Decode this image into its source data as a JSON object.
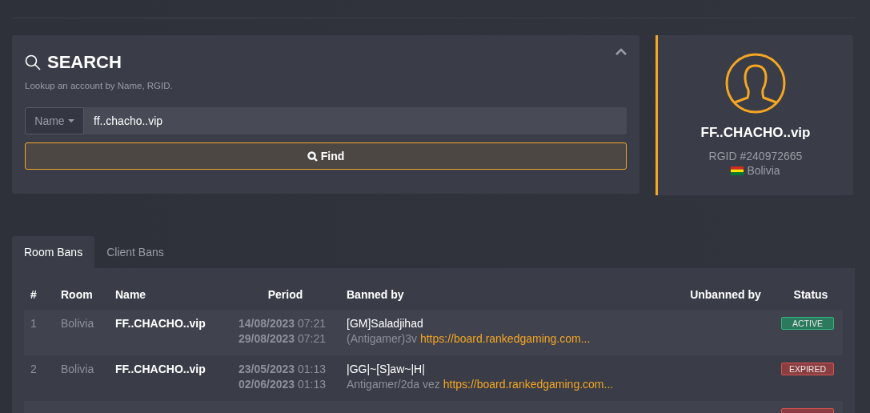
{
  "search": {
    "title": "SEARCH",
    "subtitle": "Lookup an account by Name, RGID.",
    "type_selector": "Name",
    "value": "ff..chacho..vip",
    "button": "Find",
    "collapsed": false
  },
  "profile": {
    "name": "FF..CHACHO..vip",
    "rgid": "RGID #240972665",
    "country": "Bolivia"
  },
  "tabs": [
    {
      "label": "Room Bans",
      "selected": true
    },
    {
      "label": "Client Bans",
      "selected": false
    }
  ],
  "table": {
    "columns": [
      "#",
      "Room",
      "Name",
      "Period",
      "Banned by",
      "Unbanned by",
      "Status"
    ],
    "rows": [
      {
        "index": "1",
        "room": "Bolivia",
        "name": "FF..CHACHO..vip",
        "start_date": "14/08/2023",
        "start_time": "07:21",
        "end_date": "29/08/2023",
        "end_time": "07:21",
        "banned_by": "[GM]Saladjihad",
        "reason": "(Antigamer)3v",
        "link": "https://board.rankedgaming.com...",
        "status": "ACTIVE",
        "active": true
      },
      {
        "index": "2",
        "room": "Bolivia",
        "name": "FF..CHACHO..vip",
        "start_date": "23/05/2023",
        "start_time": "01:13",
        "end_date": "02/06/2023",
        "end_time": "01:13",
        "banned_by": "|GG|~[S]aw~|H|",
        "reason": "Antigamer/2da vez",
        "link": "https://board.rankedgaming.com...",
        "status": "EXPIRED",
        "active": false
      },
      {
        "active": false
      }
    ]
  }
}
